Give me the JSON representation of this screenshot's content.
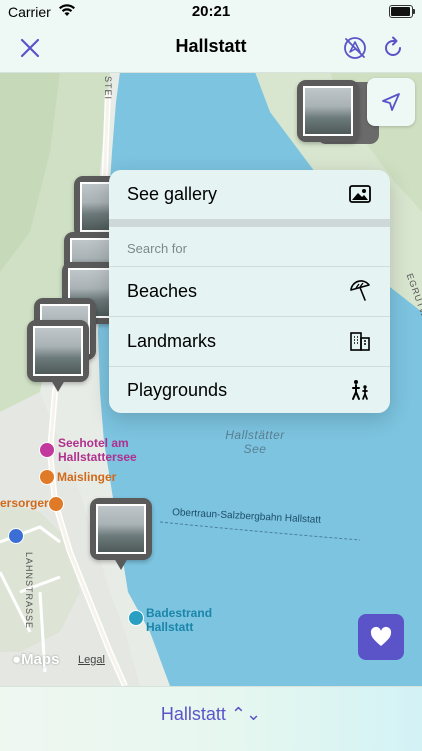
{
  "status_bar": {
    "carrier": "Carrier",
    "time": "20:21"
  },
  "nav": {
    "title": "Hallstatt"
  },
  "map": {
    "lake_label": "Hallstätter\nSee",
    "railway_label": "Obertraun-Salzbergbahn Hallstatt",
    "road_label_1": "LAHNSTRASSE",
    "road_label_2": "STEI",
    "road_label_3": "EGRUTWE",
    "pois": [
      {
        "name": "Seehotel am\nHallstattersee",
        "color": "#c2389d"
      },
      {
        "name": "Maislinger",
        "color": "#e07a27"
      },
      {
        "name": "ersorger",
        "color": "#e07a27"
      },
      {
        "name": "Badestrand\nHallstatt",
        "color": "#2a9fc2"
      }
    ],
    "attribution": "Maps",
    "legal": "Legal"
  },
  "popover": {
    "gallery_label": "See gallery",
    "search_header": "Search for",
    "options": [
      {
        "label": "Beaches",
        "icon": "beach-umbrella-icon"
      },
      {
        "label": "Landmarks",
        "icon": "building-icon"
      },
      {
        "label": "Playgrounds",
        "icon": "playground-icon"
      }
    ]
  },
  "bottom": {
    "location_picker": "Hallstatt ⌃⌄"
  },
  "colors": {
    "accent": "#5b54c9",
    "lake": "#7cc4e0",
    "land": "#e8ece6"
  }
}
